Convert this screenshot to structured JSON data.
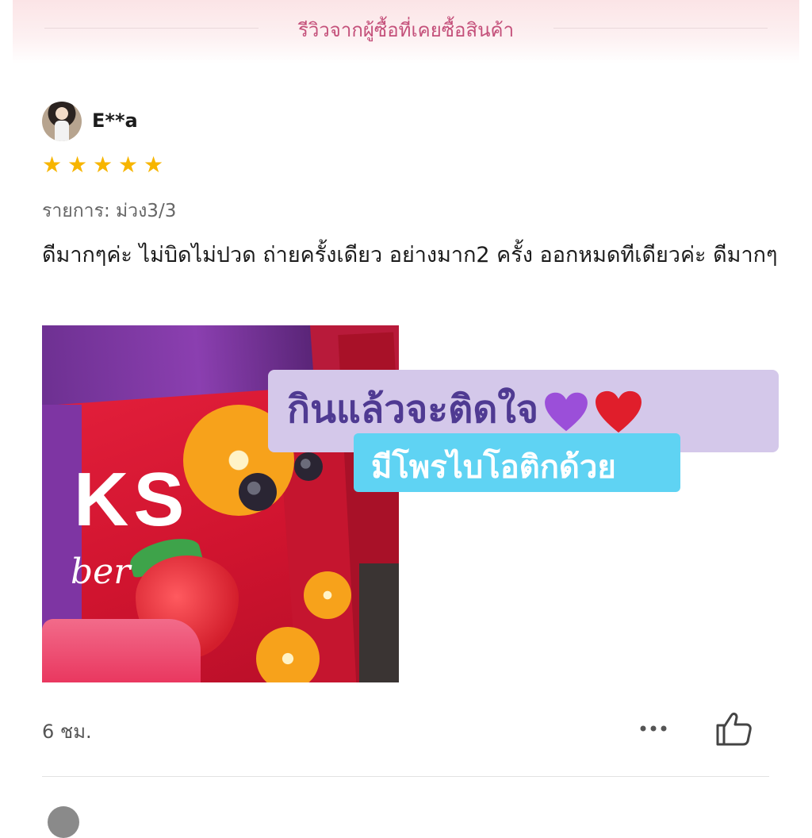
{
  "header": {
    "title": "รีวิวจากผู้ซื้อที่เคยซื้อสินค้า"
  },
  "review": {
    "username": "E**a",
    "rating": 5,
    "rating_max": 5,
    "variant": "รายการ: ม่วง3/3",
    "text": "ดีมากๆค่ะ ไม่บิดไม่ปวด ถ่ายครั้งเดียว อย่างมาก2 ครั้ง ออกหมดทีเดียวค่ะ ดีมากๆ",
    "timestamp": "6 ชม."
  },
  "photo": {
    "brand_text": "KS",
    "brand_sub": "ber"
  },
  "stickers": {
    "line1": "กินแล้วจะติดใจ",
    "line2": "มีโพรไบโอติกด้วย"
  },
  "icons": {
    "star": "star-icon",
    "more": "more-dots-icon",
    "like": "thumbs-up-icon",
    "heart_purple": "purple-heart-emoji",
    "heart_red": "red-heart-emoji"
  },
  "colors": {
    "header_title": "#c4507a",
    "star": "#f7b500",
    "sticker1_bg": "#d4c8ea",
    "sticker1_text": "#4f3a92",
    "sticker2_bg": "#5fd3f3"
  }
}
